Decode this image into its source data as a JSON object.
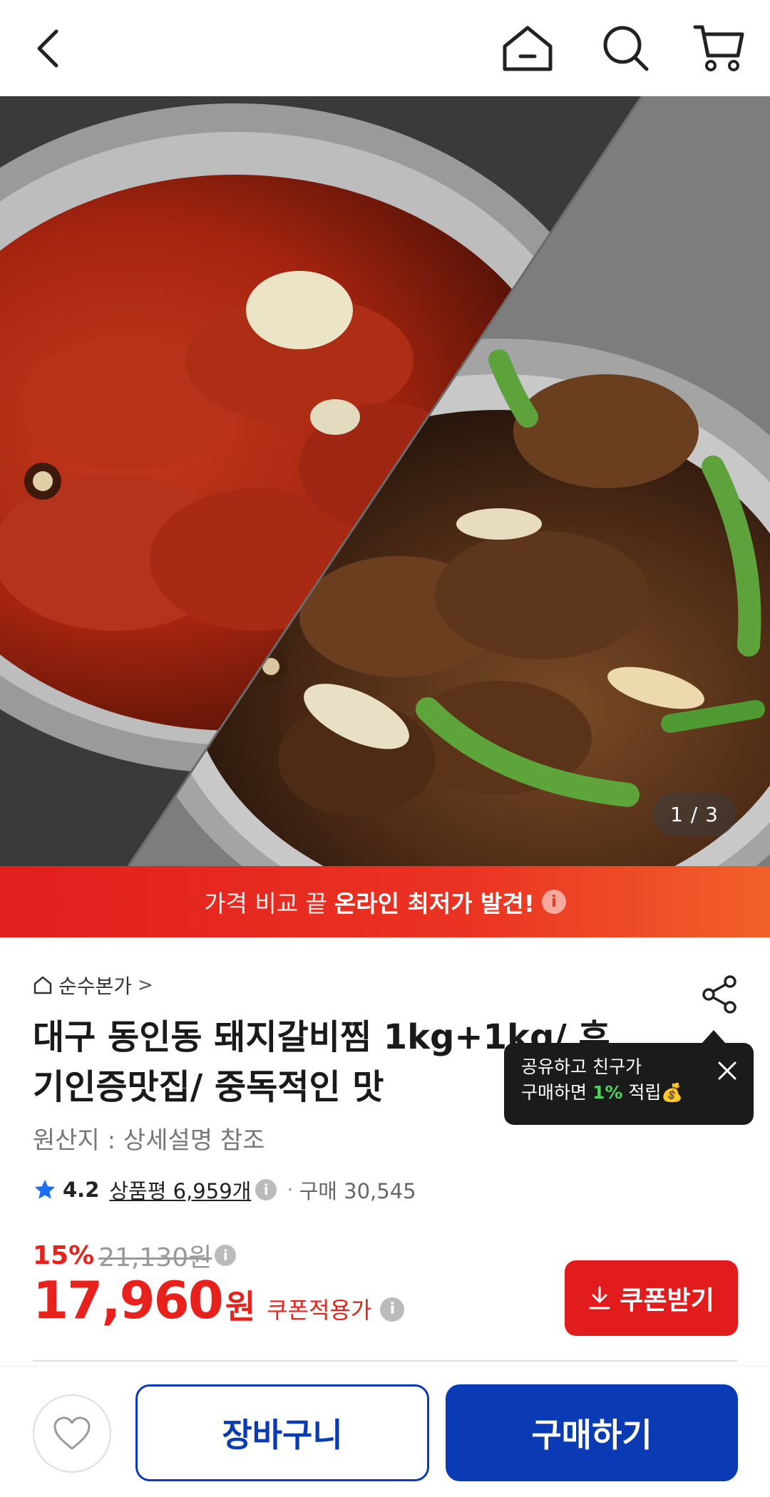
{
  "header": {
    "back_icon": "chevron-left-icon",
    "home_icon": "home-icon",
    "search_icon": "search-icon",
    "cart_icon": "cart-icon"
  },
  "gallery": {
    "pager": "1 / 3"
  },
  "banner": {
    "text_light": "가격 비교 끝",
    "text_bold": "온라인 최저가 발견!",
    "info_glyph": "i"
  },
  "product": {
    "brand": "순수본가",
    "brand_chevron": ">",
    "title": "대구 동인동 돼지갈비찜 1kg+1kg/ 후기인증맛집/ 중독적인 맛",
    "origin": "원산지 : 상세설명 참조",
    "rating": "4.2",
    "reviews": "상품평 6,959개",
    "purchases": "구매 30,545",
    "discount_pct": "15%",
    "original_price": "21,130원",
    "price": "17,960",
    "price_unit": "원",
    "coupon_label": "쿠폰적용가",
    "info_glyph": "i"
  },
  "tooltip": {
    "line1": "공유하고 친구가",
    "line2_a": "구매하면 ",
    "line2_pct": "1%",
    "line2_b": " 적립💰"
  },
  "coupon_button": {
    "label": "쿠폰받기"
  },
  "bottom": {
    "cart_label": "장바구니",
    "buy_label": "구매하기"
  },
  "colors": {
    "accent_red": "#e21c1c",
    "brand_blue": "#0a3bb5",
    "star_blue": "#1d6ff2"
  }
}
